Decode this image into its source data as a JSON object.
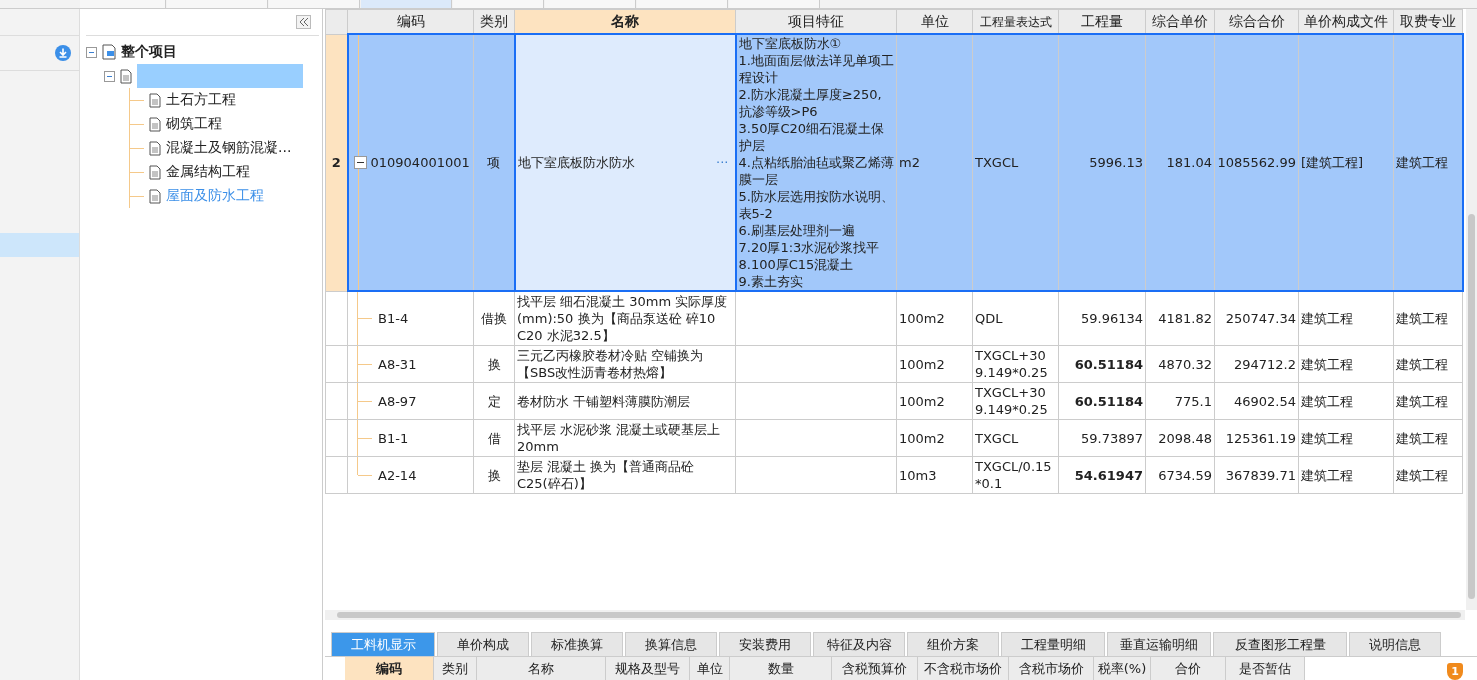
{
  "top_tabs": [
    {
      "selected": false
    },
    {
      "selected": false
    },
    {
      "selected": false
    },
    {
      "selected": true
    },
    {
      "selected": false
    },
    {
      "selected": false
    },
    {
      "selected": false
    },
    {
      "selected": false
    }
  ],
  "tree": {
    "label": "整个项目",
    "expanded": true,
    "children": [
      {
        "expanded": true,
        "children": [
          {
            "label": "土石方工程",
            "selected": false
          },
          {
            "label": "砌筑工程",
            "selected": false
          },
          {
            "label": "混凝土及钢筋混凝...",
            "selected": false
          },
          {
            "label": "金属结构工程",
            "selected": false
          },
          {
            "label": "屋面及防水工程",
            "selected": true
          }
        ]
      }
    ]
  },
  "table": {
    "columns": [
      {
        "label": "编码",
        "selected": false
      },
      {
        "label": "类别",
        "selected": false
      },
      {
        "label": "名称",
        "selected": true
      },
      {
        "label": "项目特征",
        "selected": false
      },
      {
        "label": "单位",
        "selected": false
      },
      {
        "label": "工程量表达式",
        "selected": false
      },
      {
        "label": "工程量",
        "selected": false
      },
      {
        "label": "综合单价",
        "selected": false
      },
      {
        "label": "综合合价",
        "selected": false
      },
      {
        "label": "单价构成文件",
        "selected": false
      },
      {
        "label": "取费专业",
        "selected": false
      }
    ],
    "rows": [
      {
        "kind": "item",
        "number": "2",
        "selected": true,
        "expanded": true,
        "code": "010904001001",
        "type": "项",
        "name": "地下室底板防水防水",
        "more": "···",
        "features": "地下室底板防水①\n1.地面面层做法详见单项工程设计\n2.防水混凝土厚度≥250,抗渗等级>P6\n3.50厚C20细石混凝土保护层\n4.点粘纸胎油毡或聚乙烯薄膜一层\n5.防水层选用按防水说明、表5-2\n6.刷基层处理剂一遍\n7.20厚1:3水泥砂浆找平\n8.100厚C15混凝土\n9.素土夯实",
        "unit": "m2",
        "expression": "TXGCL",
        "quantity": "5996.13",
        "bold": false,
        "unit_price": "181.04",
        "total": "1085562.99",
        "price_file": "[建筑工程]",
        "specialty": "建筑工程"
      },
      {
        "kind": "quota",
        "selected": false,
        "code": "B1-4",
        "type": "借换",
        "name": "找平层 细石混凝土 30mm  实际厚度(mm):50  换为【商品泵送砼 碎10 C20 水泥32.5】",
        "unit": "100m2",
        "expression": "QDL",
        "quantity": "59.96134",
        "bold": false,
        "unit_price": "4181.82",
        "total": "250747.34",
        "price_file": "建筑工程",
        "specialty": "建筑工程"
      },
      {
        "kind": "quota",
        "selected": false,
        "code": "A8-31",
        "type": "换",
        "name": "三元乙丙橡胶卷材冷贴 空铺换为【SBS改性沥青卷材热熔】",
        "unit": "100m2",
        "expression": "TXGCL+309.149*0.25",
        "quantity": "60.51184",
        "bold": true,
        "unit_price": "4870.32",
        "total": "294712.2",
        "price_file": "建筑工程",
        "specialty": "建筑工程"
      },
      {
        "kind": "quota",
        "selected": false,
        "code": "A8-97",
        "type": "定",
        "name": "卷材防水 干铺塑料薄膜防潮层",
        "unit": "100m2",
        "expression": "TXGCL+309.149*0.25",
        "quantity": "60.51184",
        "bold": true,
        "unit_price": "775.1",
        "total": "46902.54",
        "price_file": "建筑工程",
        "specialty": "建筑工程"
      },
      {
        "kind": "quota",
        "selected": false,
        "code": "B1-1",
        "type": "借",
        "name": "找平层 水泥砂浆 混凝土或硬基层上 20mm",
        "unit": "100m2",
        "expression": "TXGCL",
        "quantity": "59.73897",
        "bold": false,
        "unit_price": "2098.48",
        "total": "125361.19",
        "price_file": "建筑工程",
        "specialty": "建筑工程"
      },
      {
        "kind": "quota",
        "selected": false,
        "code": "A2-14",
        "type": "换",
        "name": "垫层 混凝土  换为【普通商品砼 C25(碎石)】",
        "unit": "10m3",
        "expression": "TXGCL/0.15*0.1",
        "quantity": "54.61947",
        "bold": true,
        "unit_price": "6734.59",
        "total": "367839.71",
        "price_file": "建筑工程",
        "specialty": "建筑工程"
      }
    ]
  },
  "bottom_tabs": [
    {
      "label": "工料机显示",
      "selected": true
    },
    {
      "label": "单价构成",
      "selected": false
    },
    {
      "label": "标准换算",
      "selected": false
    },
    {
      "label": "换算信息",
      "selected": false
    },
    {
      "label": "安装费用",
      "selected": false
    },
    {
      "label": "特征及内容",
      "selected": false
    },
    {
      "label": "组价方案",
      "selected": false
    },
    {
      "label": "工程量明细",
      "selected": false
    },
    {
      "label": "垂直运输明细",
      "selected": false
    },
    {
      "label": "反查图形工程量",
      "selected": false
    },
    {
      "label": "说明信息",
      "selected": false
    }
  ],
  "bottom_columns": [
    {
      "label": "编码",
      "selected": true
    },
    {
      "label": "类别",
      "selected": false
    },
    {
      "label": "名称",
      "selected": false
    },
    {
      "label": "规格及型号",
      "selected": false
    },
    {
      "label": "单位",
      "selected": false
    },
    {
      "label": "数量",
      "selected": false
    },
    {
      "label": "含税预算价",
      "selected": false
    },
    {
      "label": "不含税市场价",
      "selected": false
    },
    {
      "label": "含税市场价",
      "selected": false
    },
    {
      "label": "税率(%)",
      "selected": false
    },
    {
      "label": "合价",
      "selected": false
    },
    {
      "label": "是否暂估",
      "selected": false
    }
  ],
  "notification": {
    "count": "1"
  }
}
